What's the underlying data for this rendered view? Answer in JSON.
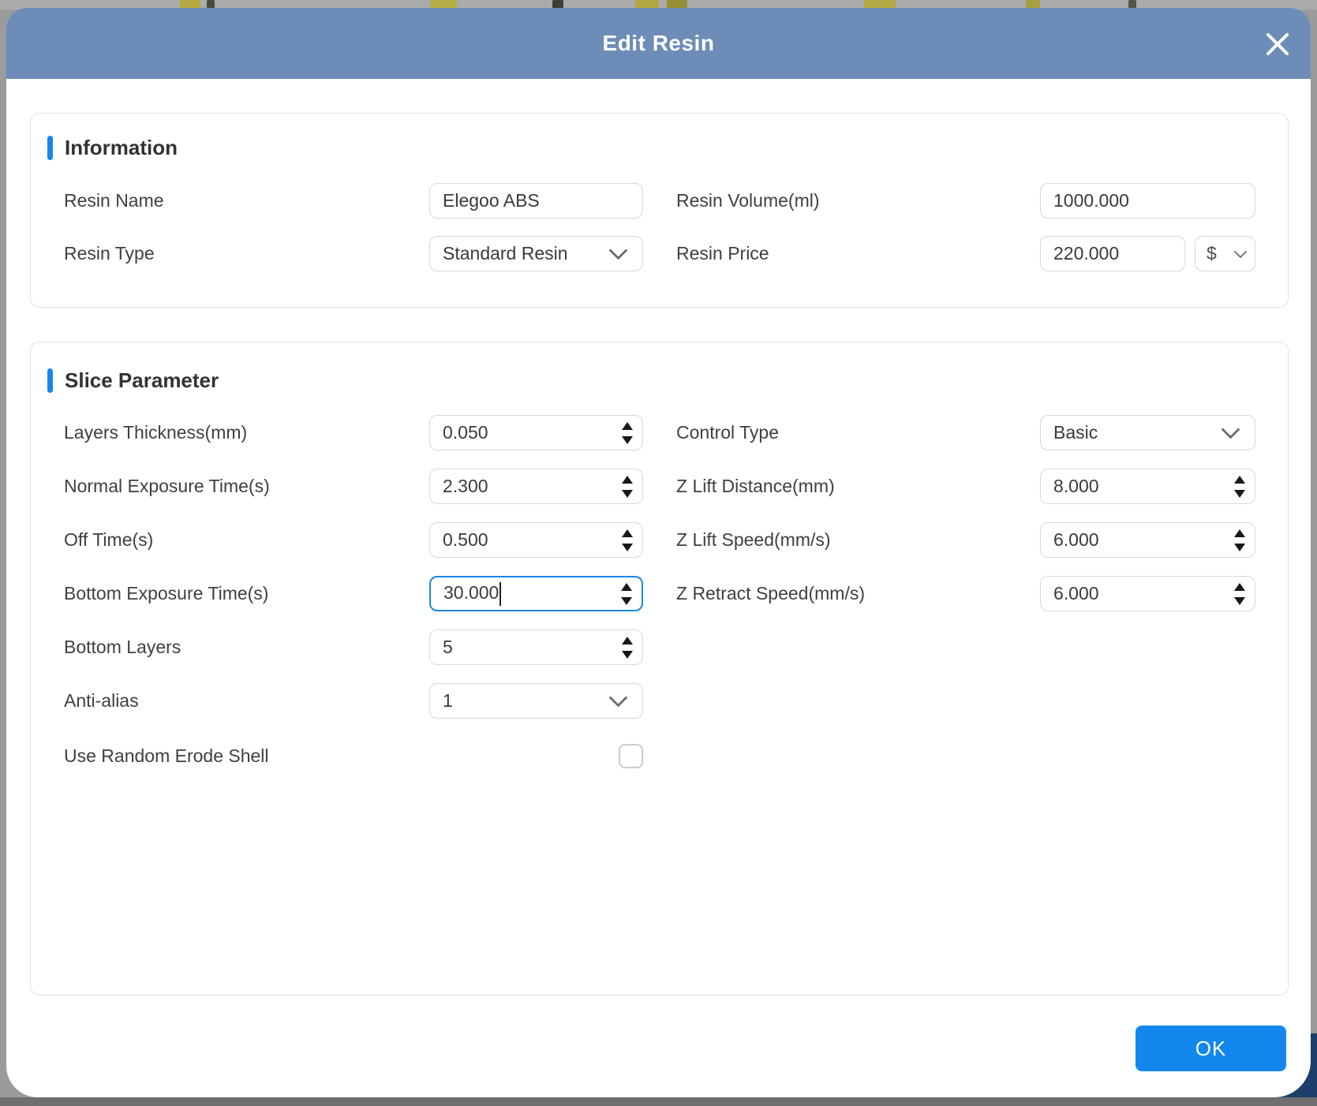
{
  "header": {
    "title": "Edit Resin"
  },
  "information": {
    "heading": "Information",
    "resin_name": {
      "label": "Resin Name",
      "value": "Elegoo ABS"
    },
    "resin_volume": {
      "label": "Resin Volume(ml)",
      "value": "1000.000"
    },
    "resin_type": {
      "label": "Resin Type",
      "value": "Standard Resin"
    },
    "resin_price": {
      "label": "Resin Price",
      "value": "220.000",
      "currency": "$"
    }
  },
  "slice": {
    "heading": "Slice Parameter",
    "layers_thickness": {
      "label": "Layers Thickness(mm)",
      "value": "0.050"
    },
    "normal_exposure": {
      "label": "Normal Exposure Time(s)",
      "value": "2.300"
    },
    "off_time": {
      "label": "Off Time(s)",
      "value": "0.500"
    },
    "bottom_exposure": {
      "label": "Bottom Exposure Time(s)",
      "value": "30.000",
      "focused": true
    },
    "bottom_layers": {
      "label": "Bottom Layers",
      "value": "5"
    },
    "anti_alias": {
      "label": "Anti-alias",
      "value": "1"
    },
    "erode_shell": {
      "label": "Use Random Erode Shell",
      "checked": false
    },
    "control_type": {
      "label": "Control Type",
      "value": "Basic"
    },
    "z_lift_distance": {
      "label": "Z Lift Distance(mm)",
      "value": "8.000"
    },
    "z_lift_speed": {
      "label": "Z Lift Speed(mm/s)",
      "value": "6.000"
    },
    "z_retract_speed": {
      "label": "Z Retract Speed(mm/s)",
      "value": "6.000"
    }
  },
  "footer": {
    "ok_label": "OK"
  },
  "icons": {
    "close": "close-icon",
    "dropdown": "chevron-down-icon",
    "spin_up": "triangle-up-icon",
    "spin_down": "triangle-down-icon"
  },
  "colors": {
    "header_bg": "#6d8cb7",
    "accent_blue": "#1787ee",
    "ok_button": "#1287ee",
    "focus_border": "#1787ee",
    "input_border": "#d7d7d7",
    "card_border": "#e2e2e2",
    "bottom_strip": "#6f6f6f",
    "navy_corner": "#1d3e6a"
  }
}
